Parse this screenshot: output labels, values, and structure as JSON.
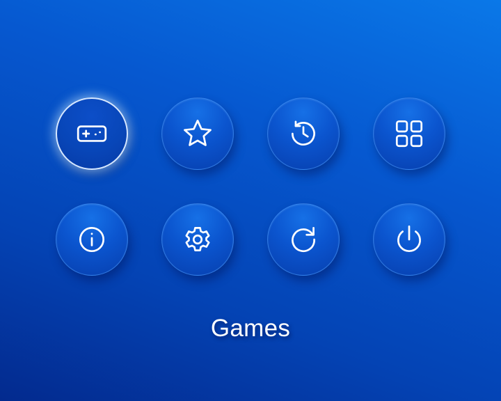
{
  "menu": {
    "selected_label": "Games",
    "items": [
      {
        "id": "games",
        "icon": "gamepad-icon",
        "selected": true
      },
      {
        "id": "favorites",
        "icon": "star-icon",
        "selected": false
      },
      {
        "id": "history",
        "icon": "history-icon",
        "selected": false
      },
      {
        "id": "apps",
        "icon": "grid-icon",
        "selected": false
      },
      {
        "id": "info",
        "icon": "info-icon",
        "selected": false
      },
      {
        "id": "settings",
        "icon": "gear-icon",
        "selected": false
      },
      {
        "id": "refresh",
        "icon": "refresh-icon",
        "selected": false
      },
      {
        "id": "power",
        "icon": "power-icon",
        "selected": false
      }
    ]
  },
  "colors": {
    "background_top": "#0a78e8",
    "background_bottom": "#032a8e",
    "button_fill": "#0b55cf",
    "selected_ring": "#d7e8ff",
    "icon": "#ffffff"
  }
}
